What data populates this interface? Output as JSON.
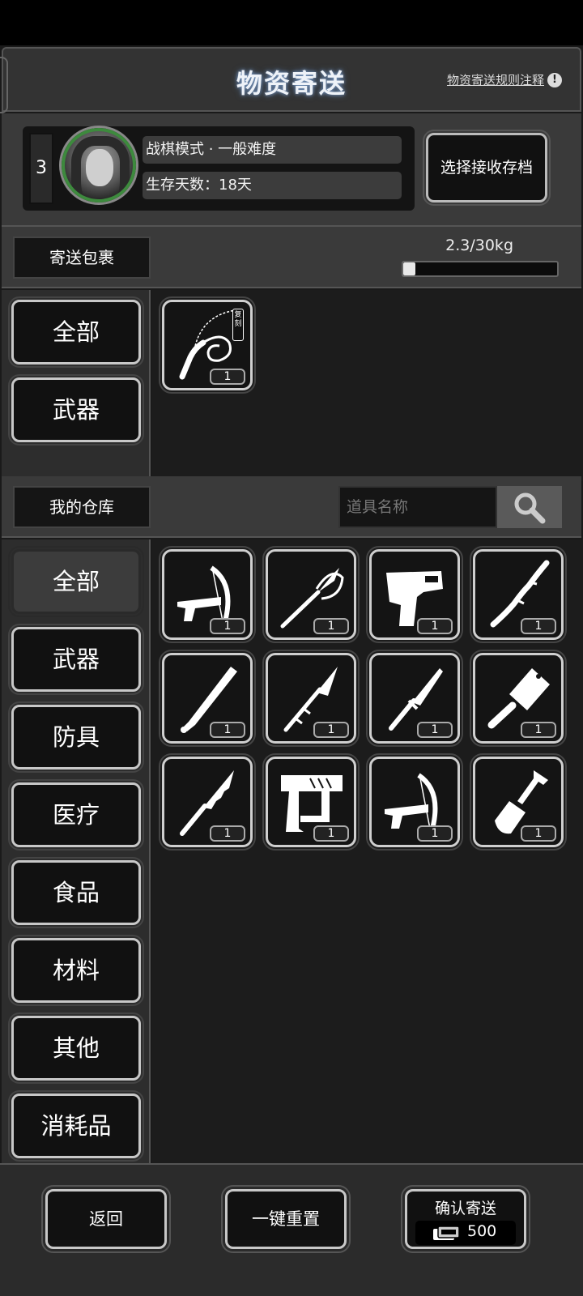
{
  "header": {
    "title": "物资寄送",
    "rules_link": "物资寄送规则注释",
    "info_icon_glyph": "!"
  },
  "profile": {
    "level": "3",
    "mode": "战棋模式 · 一般难度",
    "days": "生存天数：18天",
    "select_save_label": "选择接收存档"
  },
  "parcel": {
    "label": "寄送包裹",
    "weight_text": "2.3/30kg",
    "weight_fraction": 0.077,
    "categories": [
      {
        "label": "全部",
        "active": true
      },
      {
        "label": "武器",
        "active": false
      }
    ],
    "items": [
      {
        "icon": "whip-icon",
        "count": "1",
        "tag": "复刻"
      }
    ]
  },
  "warehouse": {
    "label": "我的仓库",
    "search_placeholder": "道具名称",
    "categories": [
      {
        "label": "全部",
        "active": false
      },
      {
        "label": "武器",
        "active": true
      },
      {
        "label": "防具",
        "active": false
      },
      {
        "label": "医疗",
        "active": false
      },
      {
        "label": "食品",
        "active": false
      },
      {
        "label": "材料",
        "active": false
      },
      {
        "label": "其他",
        "active": false
      },
      {
        "label": "消耗品",
        "active": false
      }
    ],
    "items": [
      {
        "icon": "crossbow-icon",
        "count": "1"
      },
      {
        "icon": "saber-icon",
        "count": "1"
      },
      {
        "icon": "pistol-icon",
        "count": "1"
      },
      {
        "icon": "branch-club-icon",
        "count": "1"
      },
      {
        "icon": "baseball-bat-icon",
        "count": "1"
      },
      {
        "icon": "spear-icon",
        "count": "1"
      },
      {
        "icon": "knife-icon",
        "count": "1"
      },
      {
        "icon": "cleaver-icon",
        "count": "1"
      },
      {
        "icon": "serrated-knife-icon",
        "count": "1"
      },
      {
        "icon": "nail-gun-icon",
        "count": "1"
      },
      {
        "icon": "crossbow-icon",
        "count": "1"
      },
      {
        "icon": "shovel-icon",
        "count": "1"
      }
    ]
  },
  "footer": {
    "back_label": "返回",
    "reset_label": "一键重置",
    "confirm_label": "确认寄送",
    "cost_icon": "ticket-icon",
    "cost_value": "500"
  }
}
